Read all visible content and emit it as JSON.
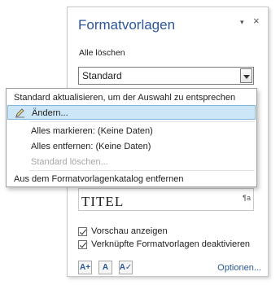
{
  "pane": {
    "title": "Formatvorlagen",
    "dropdown_icon": "▾",
    "close_icon": "×",
    "clear_all": "Alle löschen",
    "style_select": {
      "value": "Standard"
    },
    "preview": {
      "text": "TITEL",
      "mark": "¶a"
    }
  },
  "context_menu": {
    "items": [
      {
        "label": "Standard aktualisieren, um der Auswahl zu entsprechen",
        "state": "normal"
      },
      {
        "label": "Ändern...",
        "state": "highlighted",
        "icon": "pen-icon"
      },
      {
        "label": "Alles markieren: (Keine Daten)",
        "state": "normal"
      },
      {
        "label": "Alles entfernen: (Keine Daten)",
        "state": "normal"
      },
      {
        "label": "Standard löschen...",
        "state": "disabled"
      },
      {
        "label": "Aus dem Formatvorlagenkatalog entfernen",
        "state": "normal"
      }
    ]
  },
  "options": {
    "show_preview": {
      "label": "Vorschau anzeigen",
      "checked": true
    },
    "disable_linked": {
      "label": "Verknüpfte Formatvorlagen deaktivieren",
      "checked": true
    },
    "options_link": "Optionen..."
  },
  "tool_buttons": [
    {
      "name": "new-style-icon",
      "glyph": "A+"
    },
    {
      "name": "style-inspector-icon",
      "glyph": "A"
    },
    {
      "name": "manage-styles-icon",
      "glyph": "A✓"
    }
  ],
  "colors": {
    "accent": "#2b579a",
    "highlight_bg": "#cde6f7",
    "highlight_border": "#7fb4dd",
    "disabled": "#a6a6a6"
  }
}
